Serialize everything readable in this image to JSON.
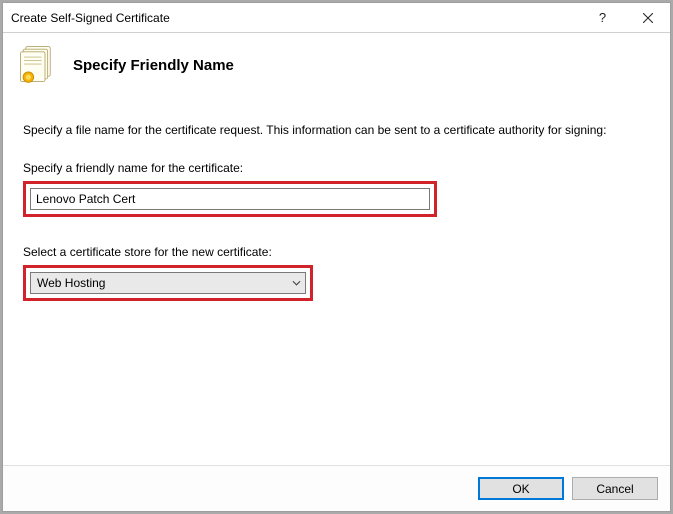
{
  "window": {
    "title": "Create Self-Signed Certificate"
  },
  "header": {
    "heading": "Specify Friendly Name"
  },
  "body": {
    "description": "Specify a file name for the certificate request.  This information can be sent to a certificate authority for signing:",
    "friendly_label": "Specify a friendly name for the certificate:",
    "friendly_value": "Lenovo Patch Cert",
    "store_label": "Select a certificate store for the new certificate:",
    "store_value": "Web Hosting"
  },
  "buttons": {
    "ok": "OK",
    "cancel": "Cancel"
  }
}
